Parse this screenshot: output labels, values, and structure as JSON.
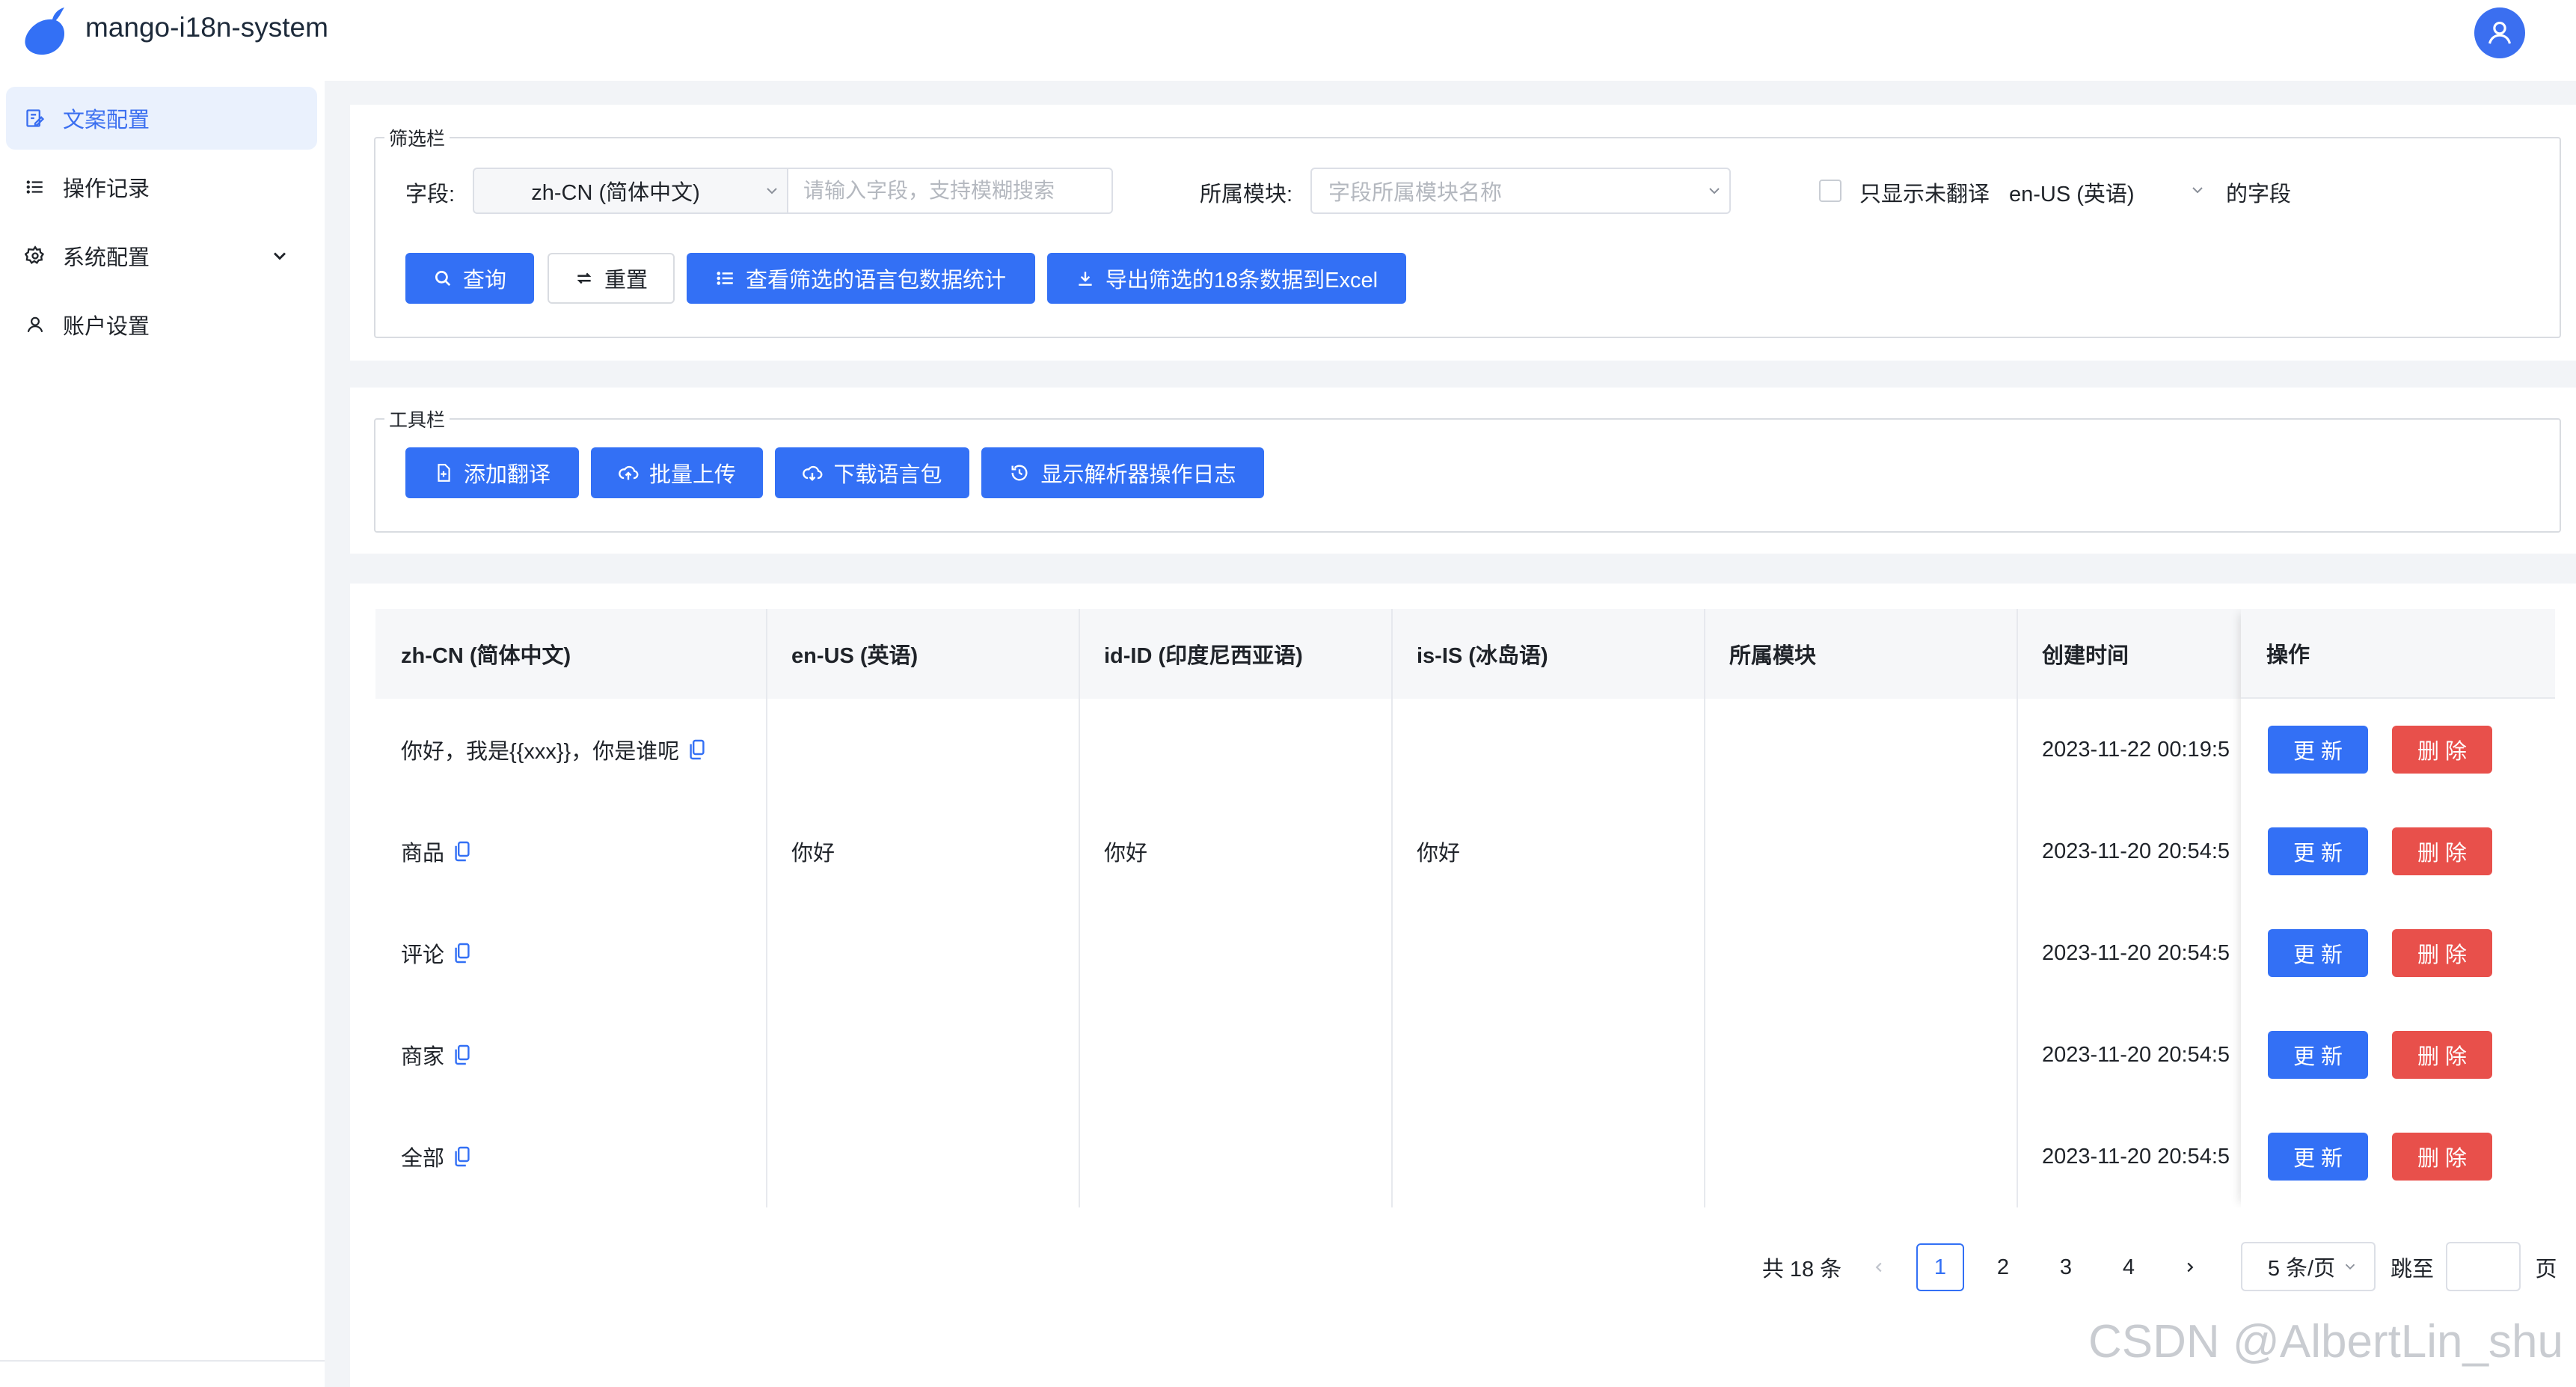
{
  "app": {
    "title": "mango-i18n-system"
  },
  "colors": {
    "primary": "#3370f5",
    "danger": "#e8504b",
    "active_nav_bg": "#eaf1fd"
  },
  "sidebar": {
    "items": [
      {
        "label": "文案配置",
        "icon": "file-edit-icon",
        "active": true
      },
      {
        "label": "操作记录",
        "icon": "list-icon",
        "active": false
      },
      {
        "label": "系统配置",
        "icon": "gear-icon",
        "active": false,
        "expandable": true
      },
      {
        "label": "账户设置",
        "icon": "user-icon",
        "active": false
      }
    ]
  },
  "filter": {
    "legend": "筛选栏",
    "field_label": "字段:",
    "lang_select": "zh-CN (简体中文)",
    "field_placeholder": "请输入字段，支持模糊搜索",
    "module_label": "所属模块:",
    "module_placeholder": "字段所属模块名称",
    "untranslated_label": "只显示未翻译",
    "untranslated_lang": "en-US (英语)",
    "suffix": "的字段",
    "buttons": {
      "query": "查询",
      "reset": "重置",
      "stats": "查看筛选的语言包数据统计",
      "export": "导出筛选的18条数据到Excel"
    }
  },
  "toolbar": {
    "legend": "工具栏",
    "buttons": {
      "add": "添加翻译",
      "batch_upload": "批量上传",
      "download": "下载语言包",
      "log": "显示解析器操作日志"
    }
  },
  "table": {
    "columns": [
      "zh-CN (简体中文)",
      "en-US (英语)",
      "id-ID (印度尼西亚语)",
      "is-IS (冰岛语)",
      "所属模块",
      "创建时间",
      "操作"
    ],
    "rows": [
      {
        "zh": "你好，我是{{xxx}}，你是谁呢",
        "en": "",
        "id": "",
        "is": "",
        "module": "",
        "created": "2023-11-22 00:19:5"
      },
      {
        "zh": "商品",
        "en": "你好",
        "id": "你好",
        "is": "你好",
        "module": "",
        "created": "2023-11-20 20:54:5"
      },
      {
        "zh": "评论",
        "en": "",
        "id": "",
        "is": "",
        "module": "",
        "created": "2023-11-20 20:54:5"
      },
      {
        "zh": "商家",
        "en": "",
        "id": "",
        "is": "",
        "module": "",
        "created": "2023-11-20 20:54:5"
      },
      {
        "zh": "全部",
        "en": "",
        "id": "",
        "is": "",
        "module": "",
        "created": "2023-11-20 20:54:5"
      }
    ],
    "actions": {
      "update": "更 新",
      "delete": "删 除"
    }
  },
  "pagination": {
    "total": "共 18 条",
    "pages": [
      "1",
      "2",
      "3",
      "4"
    ],
    "current": "1",
    "page_size": "5 条/页",
    "jump_label": "跳至",
    "page_suffix": "页"
  },
  "watermark": "CSDN @AlbertLin_shu"
}
